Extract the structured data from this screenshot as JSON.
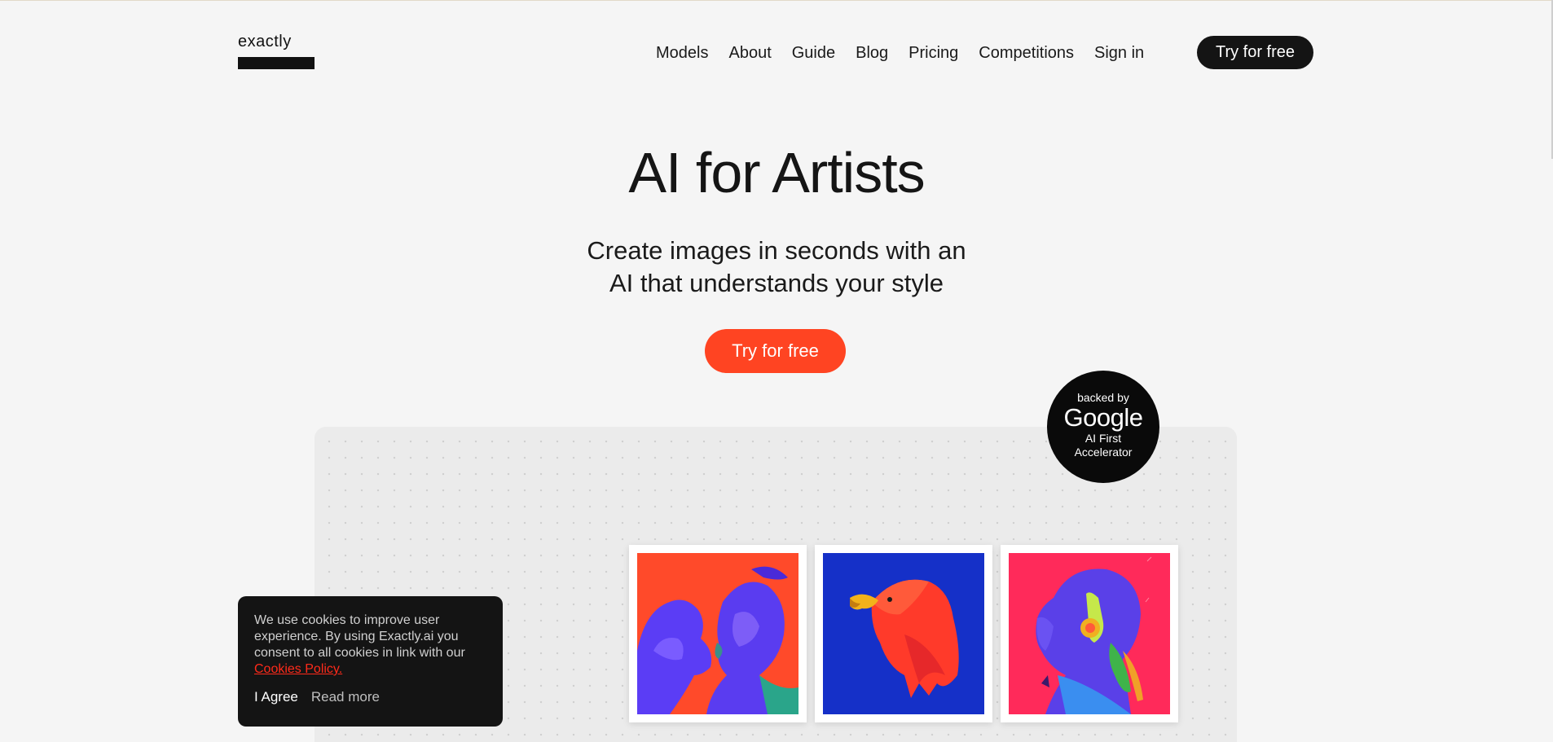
{
  "header": {
    "logo_text": "exactly",
    "nav": [
      "Models",
      "About",
      "Guide",
      "Blog",
      "Pricing",
      "Competitions",
      "Sign in"
    ],
    "cta_label": "Try for free"
  },
  "hero": {
    "title": "AI for Artists",
    "subtitle_line1": "Create images in seconds with an",
    "subtitle_line2": "AI that understands your style",
    "cta_label": "Try for free"
  },
  "badge": {
    "top": "backed by",
    "brand": "Google",
    "bottom": "AI First Accelerator"
  },
  "cookie": {
    "text": "We use cookies to improve user experience. By using Exactly.ai you consent to all cookies in link with our",
    "link_label": "Cookies Policy.",
    "agree_label": "I Agree",
    "read_more_label": "Read more"
  },
  "colors": {
    "background": "#f5f5f5",
    "accent": "#ff4422",
    "dark": "#141414"
  }
}
